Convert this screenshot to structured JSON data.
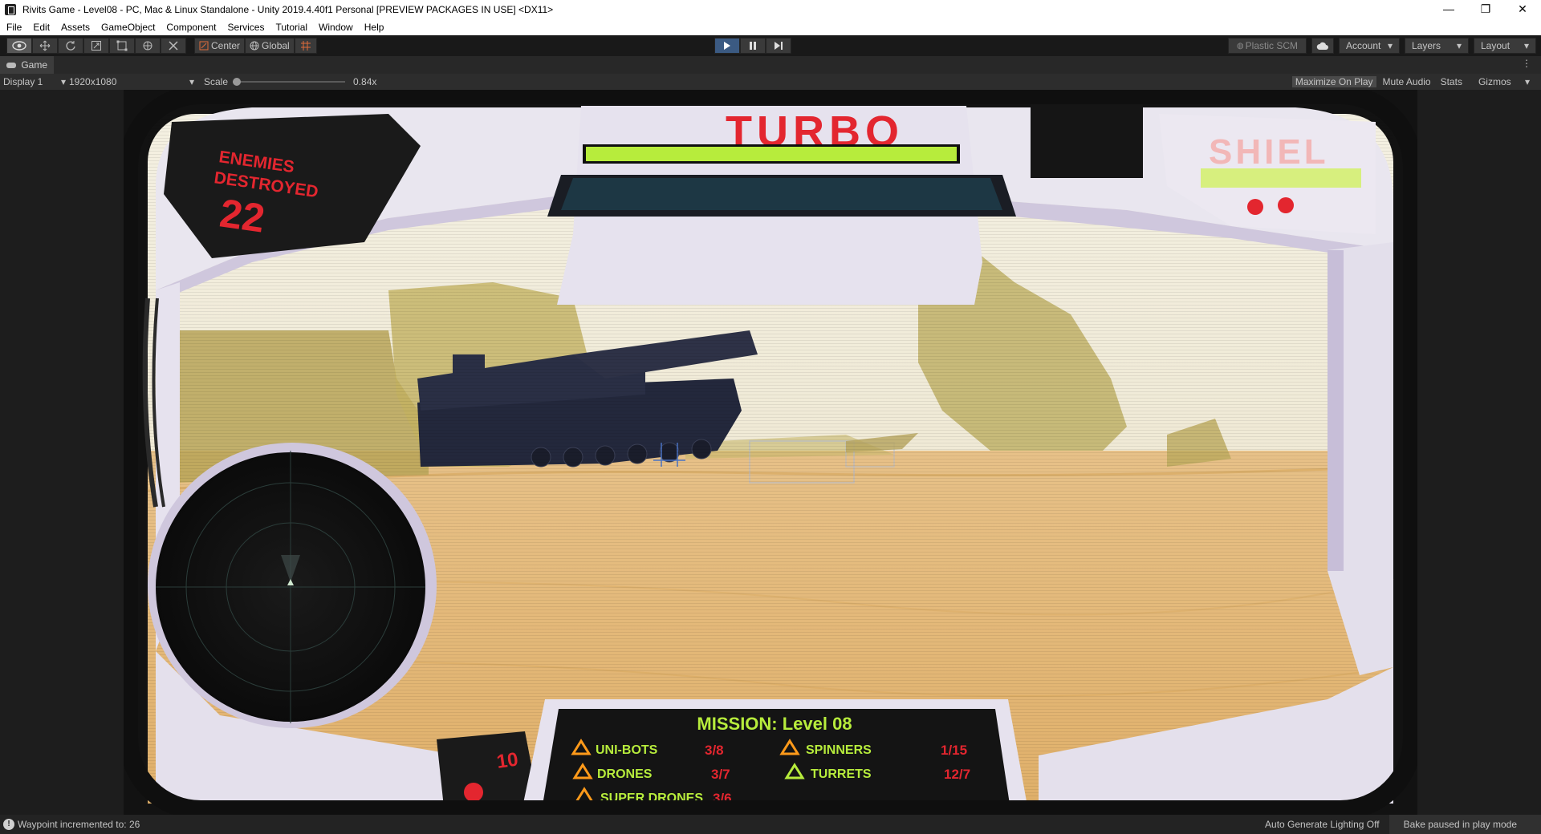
{
  "window": {
    "title": "Rivits Game - Level08 - PC, Mac & Linux Standalone - Unity 2019.4.40f1 Personal [PREVIEW PACKAGES IN USE] <DX11>",
    "minimize": "—",
    "maximize": "❐",
    "close": "✕"
  },
  "menu": [
    "File",
    "Edit",
    "Assets",
    "GameObject",
    "Component",
    "Services",
    "Tutorial",
    "Window",
    "Help"
  ],
  "toolbar": {
    "center_label": "Center",
    "global_label": "Global",
    "plastic_label": "Plastic SCM",
    "account_label": "Account",
    "layers_label": "Layers",
    "layout_label": "Layout",
    "dropdown_arrow": "▾"
  },
  "tab": {
    "label": "Game"
  },
  "game_toolbar": {
    "display": "Display 1",
    "resolution": "1920x1080",
    "scale_label": "Scale",
    "scale_value": "0.84x",
    "maximize_on_play": "Maximize On Play",
    "mute_audio": "Mute Audio",
    "stats": "Stats",
    "gizmos": "Gizmos"
  },
  "hud": {
    "enemies_line1": "ENEMIES",
    "enemies_line2": "DESTROYED",
    "enemies_count": "22",
    "turbo": "TURBO",
    "shield": "SHIEL",
    "mission_title": "MISSION: Level 08",
    "lives": "10",
    "stats": [
      {
        "name": "UNI-BOTS",
        "value": "3/8"
      },
      {
        "name": "SPINNERS",
        "value": "1/15"
      },
      {
        "name": "DRONES",
        "value": "3/7"
      },
      {
        "name": "TURRETS",
        "value": "12/7"
      },
      {
        "name": "SUPER DRONES",
        "value": "3/6"
      }
    ]
  },
  "status": {
    "message": "Waypoint incremented to: 26",
    "lighting": "Auto Generate Lighting Off",
    "bake": "Bake paused in play mode"
  },
  "colors": {
    "hud_red": "#e3262f",
    "hud_green": "#b7ec3c",
    "hud_orange": "#ff9a1a",
    "sand": "#e9c386",
    "sky": "#f3efe2",
    "playing": "#3b5a82"
  }
}
